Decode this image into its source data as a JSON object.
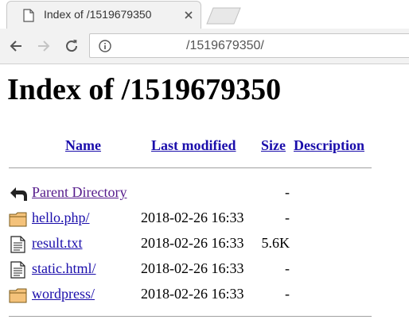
{
  "browser": {
    "tab_title": "Index of /1519679350",
    "url": "/1519679350/"
  },
  "page": {
    "heading": "Index of /1519679350",
    "columns": {
      "name": "Name",
      "last_modified": "Last modified",
      "size": "Size",
      "description": "Description"
    },
    "rows": [
      {
        "icon": "back-arrow-icon",
        "name": "Parent Directory",
        "modified": "",
        "size": "-"
      },
      {
        "icon": "folder-icon",
        "name": "hello.php/",
        "modified": "2018-02-26 16:33",
        "size": "-"
      },
      {
        "icon": "text-file-icon",
        "name": "result.txt",
        "modified": "2018-02-26 16:33",
        "size": "5.6K"
      },
      {
        "icon": "text-file-icon",
        "name": "static.html/",
        "modified": "2018-02-26 16:33",
        "size": "-"
      },
      {
        "icon": "folder-icon",
        "name": "wordpress/",
        "modified": "2018-02-26 16:33",
        "size": "-"
      }
    ]
  },
  "colors": {
    "link": "#1a0dab",
    "visited_link": "#551a8b",
    "toolbar_bg": "#f2f2f2",
    "folder_fill": "#f4c27a"
  }
}
